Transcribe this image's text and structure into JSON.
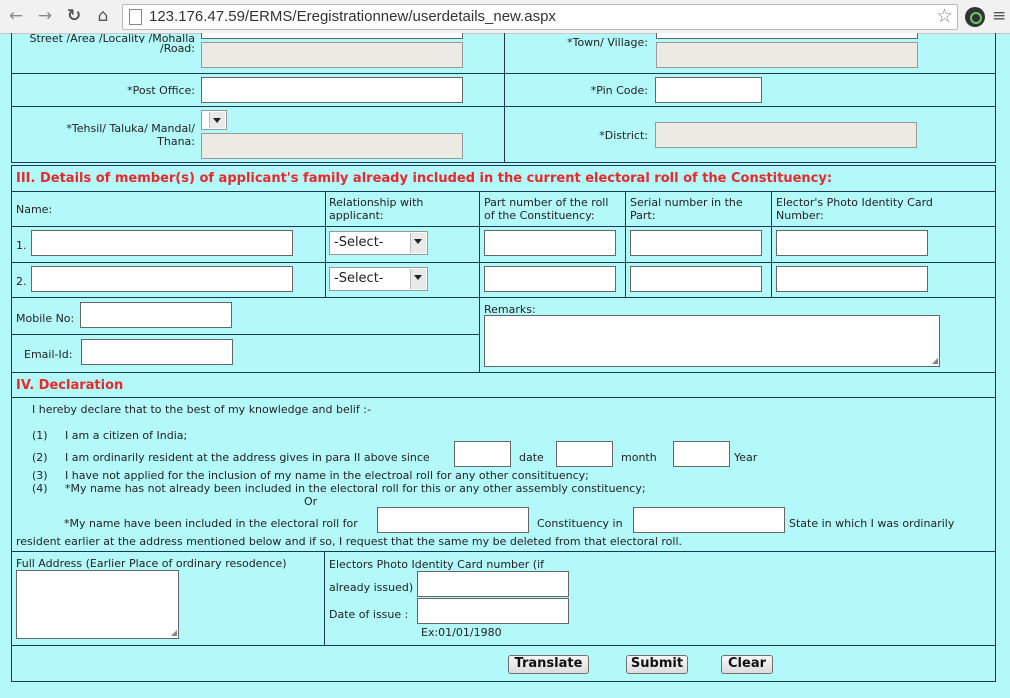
{
  "browser": {
    "url": "123.176.47.59/ERMS/Eregistrationnew/userdetails_new.aspx"
  },
  "address": {
    "street_label_1": "Street /Area /Locality /Mohalla",
    "street_label_2": "/Road:",
    "town_label": "*Town/ Village:",
    "post_office_label": "*Post Office:",
    "pin_code_label": "*Pin Code:",
    "tehsil_label_1": "*Tehsil/ Taluka/ Mandal/",
    "tehsil_label_2": "Thana:",
    "district_label": "*District:"
  },
  "family": {
    "title": "III. Details of member(s) of applicant's family already included in the current electoral roll of the Constituency:",
    "headers": {
      "name": "Name:",
      "relationship": [
        "Relationship with",
        "applicant:"
      ],
      "part_number": [
        "Part number of the roll",
        "of the Constituency:"
      ],
      "serial_number": [
        "Serial number in the",
        "Part:"
      ],
      "epic": [
        "Elector's Photo Identity Card",
        "Number:"
      ]
    },
    "rows": [
      {
        "index": "1.",
        "relationship": "-Select-"
      },
      {
        "index": "2.",
        "relationship": "-Select-"
      }
    ],
    "mobile_label": "Mobile No:",
    "email_label": "Email-Id:",
    "remarks_label": "Remarks:"
  },
  "declaration": {
    "title": "IV. Declaration",
    "intro": "I hereby declare that to the best of my knowledge and belif :-",
    "items": [
      {
        "num": "(1)",
        "text": "I am a citizen of India;"
      },
      {
        "num": "(2)",
        "text": "I am ordinarily resident at the address gives in para II above since"
      },
      {
        "num": "(3)",
        "text": "I have not applied for the inclusion of my name in the electroal roll for any other consitituency;"
      },
      {
        "num": "(4)",
        "text": "*My name has not already been included in the electoral roll for this or any other assembly constituency;"
      }
    ],
    "date_label": "date",
    "month_label": "month",
    "year_label": "Year",
    "or_label": "Or",
    "included_text": "*My name have been included in the electoral roll for",
    "constituency_in": "Constituency in",
    "state_text": "State in which I was ordinarily",
    "resident_text": "resident earlier at the address mentioned below and if so, I request that the same my be deleted from that electoral roll."
  },
  "earlier": {
    "full_address_label": "Full Address (Earlier Place of ordinary resodence)",
    "epic_label_1": "Electors Photo Identity Card number (if",
    "epic_label_2": "already issued)",
    "date_issue_label": "Date of issue :",
    "date_hint": "Ex:01/01/1980"
  },
  "buttons": {
    "translate": "Translate",
    "submit": "Submit",
    "clear": "Clear"
  }
}
